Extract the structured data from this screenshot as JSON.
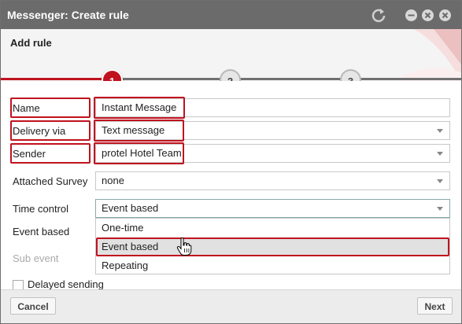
{
  "window": {
    "title": "Messenger: Create rule"
  },
  "header": {
    "title": "Add rule"
  },
  "steps": [
    "1",
    "2",
    "3"
  ],
  "form": {
    "name": {
      "label": "Name",
      "value": "Instant Message"
    },
    "delivery": {
      "label": "Delivery via",
      "value": "Text message"
    },
    "sender": {
      "label": "Sender",
      "value": "protel Hotel Team"
    },
    "survey": {
      "label": "Attached Survey",
      "value": "none"
    },
    "time_control": {
      "label": "Time control",
      "value": "Event based"
    },
    "event_based": {
      "label": "Event based"
    },
    "sub_event": {
      "label": "Sub event"
    },
    "delayed": {
      "label": "Delayed sending"
    }
  },
  "dropdown": {
    "options": [
      "One-time",
      "Event based",
      "Repeating"
    ]
  },
  "footer": {
    "cancel": "Cancel",
    "next": "Next"
  },
  "colors": {
    "accent": "#c0121f",
    "titlebar": "#6b6b6b"
  }
}
